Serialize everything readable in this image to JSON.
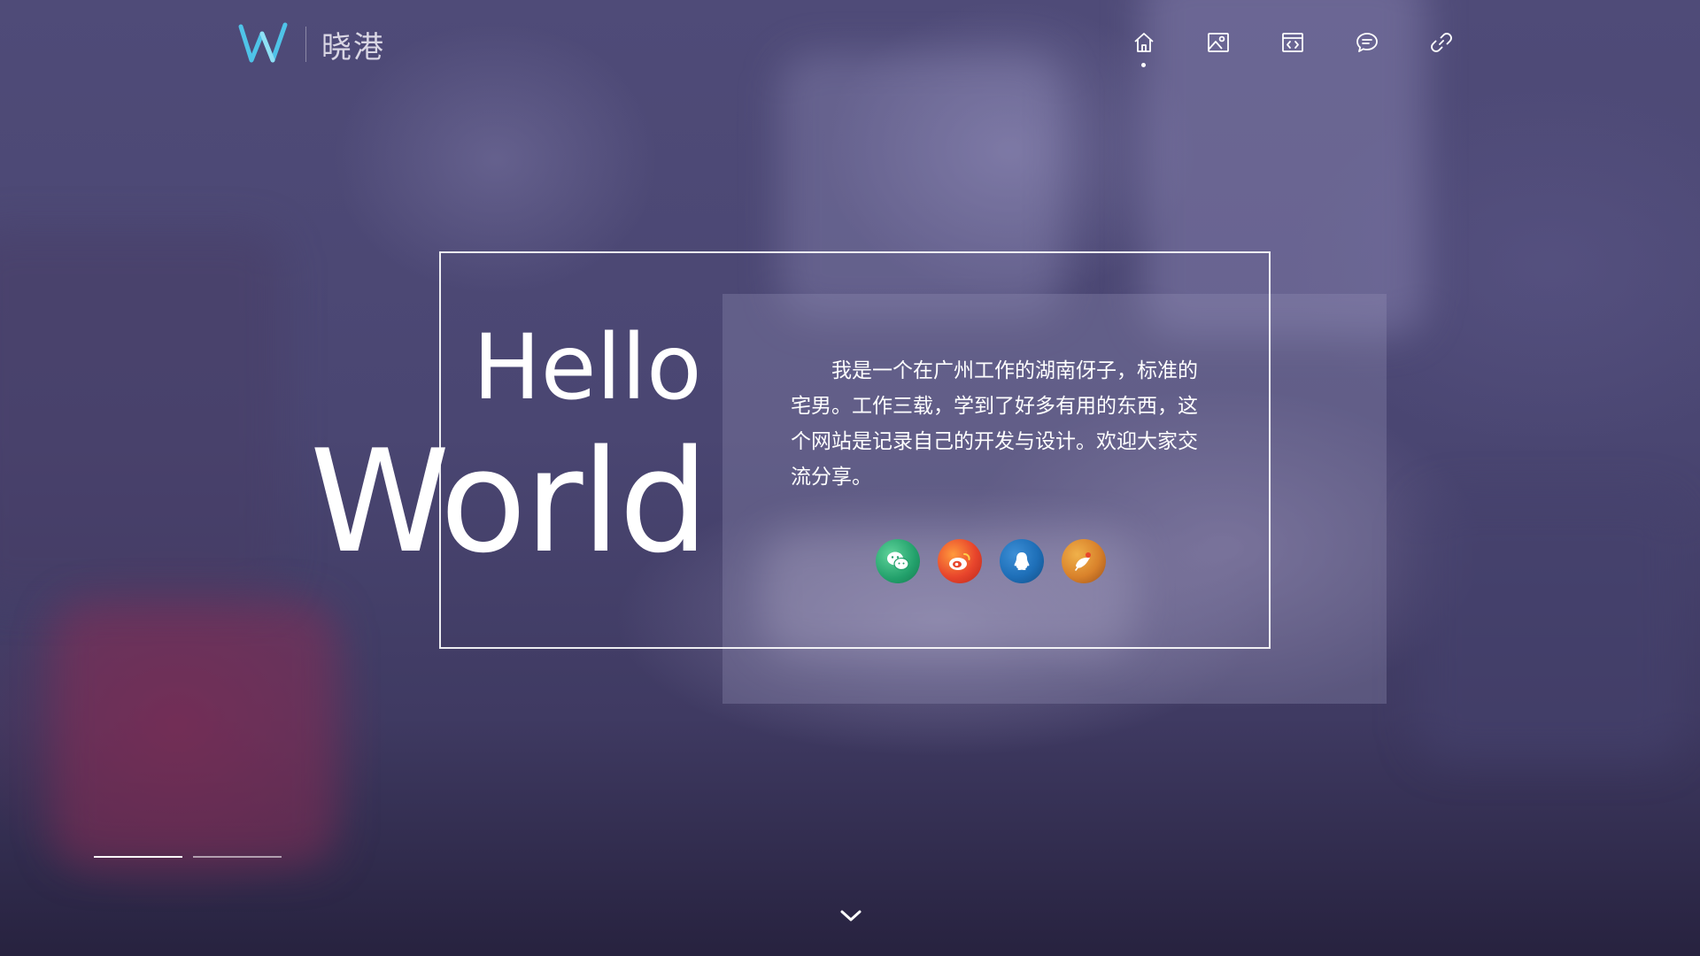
{
  "brand": {
    "name": "晓港",
    "logo_icon": "w-logo-icon",
    "accent": "#4fc3e8"
  },
  "nav": {
    "items": [
      {
        "icon": "home-icon",
        "active": true
      },
      {
        "icon": "gallery-icon",
        "active": false
      },
      {
        "icon": "code-window-icon",
        "active": false
      },
      {
        "icon": "message-icon",
        "active": false
      },
      {
        "icon": "link-icon",
        "active": false
      }
    ]
  },
  "hero": {
    "hello": "Hello",
    "world": "World",
    "intro": "我是一个在广州工作的湖南伢子，标准的宅男。工作三载，学到了好多有用的东西，这个网站是记录自己的开发与设计。欢迎大家交流分享。"
  },
  "socials": [
    {
      "icon": "wechat-icon",
      "color": "#2bb673"
    },
    {
      "icon": "weibo-icon",
      "color": "#e8452c"
    },
    {
      "icon": "qq-icon",
      "color": "#1e6fb8"
    },
    {
      "icon": "taobao-icon",
      "color": "#d9822b"
    }
  ],
  "slider": {
    "slides": 2,
    "active_index": 0
  },
  "scroll_down_icon": "chevron-down-icon"
}
